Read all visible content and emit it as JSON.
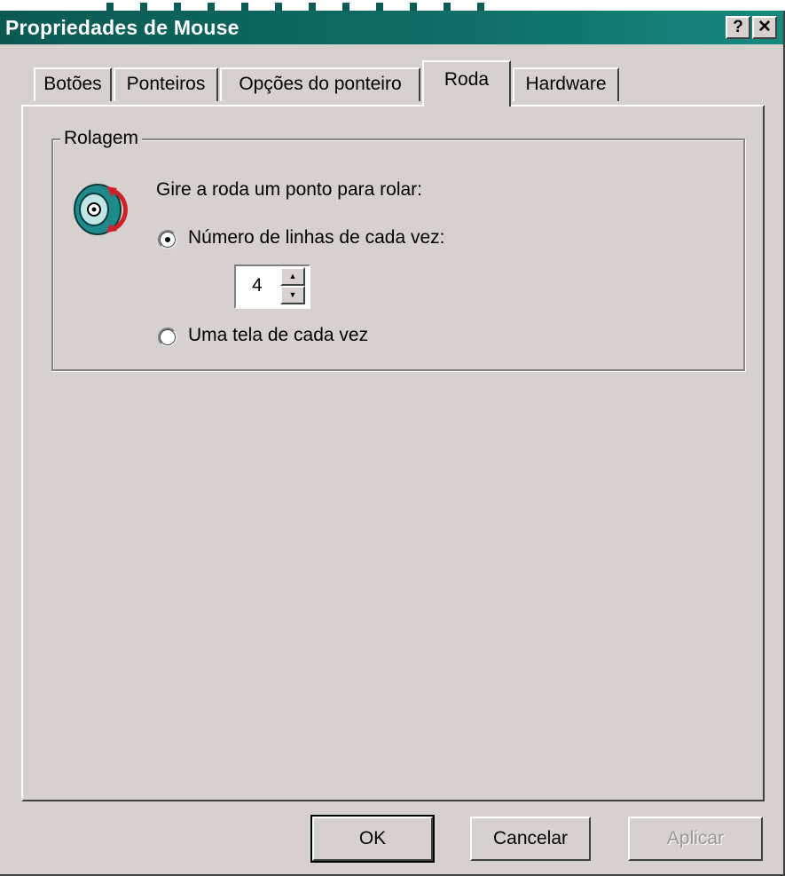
{
  "window": {
    "title": "Propriedades de Mouse",
    "help_glyph": "?",
    "close_glyph": "✕"
  },
  "tabs": [
    {
      "label": "Botões",
      "active": false
    },
    {
      "label": "Ponteiros",
      "active": false
    },
    {
      "label": "Opções do ponteiro",
      "active": false
    },
    {
      "label": "Roda",
      "active": true
    },
    {
      "label": "Hardware",
      "active": false
    }
  ],
  "scrolling": {
    "group_label": "Rolagem",
    "instruction": "Gire a roda um ponto para rolar:",
    "lines_option": {
      "label": "Número de linhas de cada vez:",
      "selected": true
    },
    "lines_value": "4",
    "screen_option": {
      "label": "Uma tela de cada vez",
      "selected": false
    }
  },
  "buttons": {
    "ok": "OK",
    "cancel": "Cancelar",
    "apply": "Aplicar"
  },
  "colors": {
    "titlebar": "#0f6f66",
    "face": "#d6d0ce",
    "wheel_icon": "#1e8a8a",
    "wheel_arrow": "#d0202a"
  },
  "icons": {
    "mouse_wheel": "mouse-wheel-icon"
  }
}
